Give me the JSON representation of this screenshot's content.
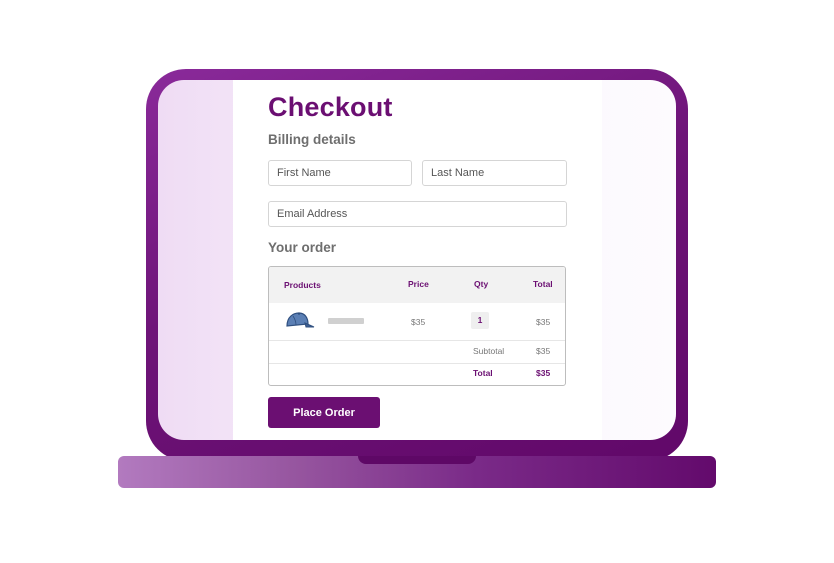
{
  "checkout": {
    "title": "Checkout",
    "billing_heading": "Billing details",
    "first_name_placeholder": "First Name",
    "last_name_placeholder": "Last Name",
    "email_placeholder": "Email Address",
    "order_heading": "Your order",
    "table": {
      "headers": {
        "products": "Products",
        "price": "Price",
        "qty": "Qty",
        "total": "Total"
      },
      "item": {
        "icon": "baseball-cap-icon",
        "price": "$35",
        "qty": "1",
        "total": "$35"
      },
      "subtotal_label": "Subtotal",
      "subtotal_value": "$35",
      "total_label": "Total",
      "total_value": "$35"
    },
    "place_order_label": "Place Order"
  },
  "colors": {
    "brand": "#6b0f72",
    "laptop": "#6e1478"
  }
}
